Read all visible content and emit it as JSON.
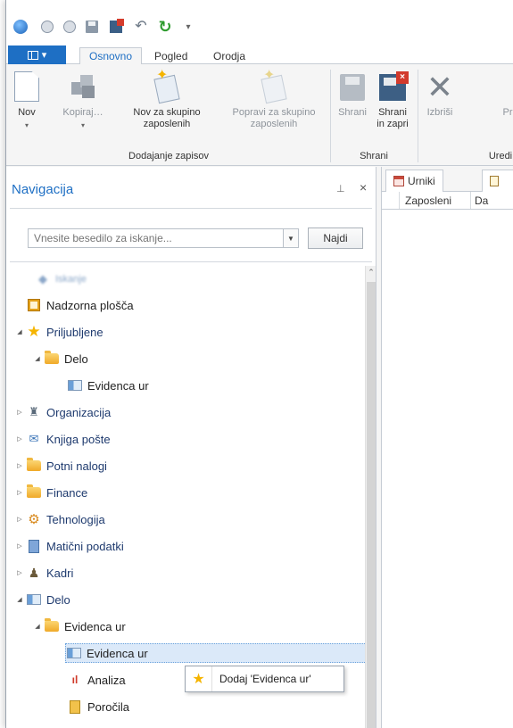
{
  "quick_access": {
    "icons": [
      "app-orb-icon",
      "back-icon",
      "forward-icon",
      "save-icon",
      "save-close-icon",
      "undo-icon",
      "refresh-icon",
      "customize-icon"
    ]
  },
  "ribbon_tabs": {
    "file_label": "",
    "tabs": [
      "Osnovno",
      "Pogled",
      "Orodja"
    ],
    "active": "Osnovno"
  },
  "ribbon": {
    "buttons": {
      "nov": "Nov",
      "kopiraj": "Kopiraj…",
      "nov_skupino_1": "Nov za skupino",
      "nov_skupino_2": "zaposlenih",
      "popravi_1": "Popravi za skupino",
      "popravi_2": "zaposlenih",
      "shrani": "Shrani",
      "shrani_zapri_1": "Shrani",
      "shrani_zapri_2": "in zapri",
      "izbrisi": "Izbriši",
      "cut_off": "Pr"
    },
    "groups": {
      "dodajanje": "Dodajanje zapisov",
      "shrani": "Shrani",
      "uredi": "Uredi"
    }
  },
  "navigation": {
    "title": "Navigacija",
    "pin_glyph": "ᵖ",
    "close_glyph": "×",
    "search_placeholder": "Vnesite besedilo za iskanje...",
    "search_button": "Najdi",
    "tree": [
      {
        "label": "<blurred>",
        "level": 0
      },
      {
        "label": "Nadzorna plošča",
        "level": 0
      },
      {
        "label": "Priljubljene",
        "level": 0
      },
      {
        "label": "Delo",
        "level": 1
      },
      {
        "label": "Evidenca ur",
        "level": 2
      },
      {
        "label": "Organizacija",
        "level": 0
      },
      {
        "label": "Knjiga pošte",
        "level": 0
      },
      {
        "label": "Potni nalogi",
        "level": 0
      },
      {
        "label": "Finance",
        "level": 0
      },
      {
        "label": "Tehnologija",
        "level": 0
      },
      {
        "label": "Matični podatki",
        "level": 0
      },
      {
        "label": "Kadri",
        "level": 0
      },
      {
        "label": "Delo",
        "level": 0
      },
      {
        "label": "Evidenca ur",
        "level": 1
      },
      {
        "label": "Evidenca ur",
        "level": 2
      },
      {
        "label": "Analiza",
        "level": 2
      },
      {
        "label": "Poročila",
        "level": 2
      }
    ],
    "blurred_label": "Iskanje"
  },
  "context_menu": {
    "item": "Dodaj 'Evidenca ur'"
  },
  "document": {
    "tabs": [
      "Urniki",
      ""
    ],
    "columns": [
      "Zaposleni",
      "Da"
    ]
  },
  "colors": {
    "accent": "#1e6fc4",
    "tree_text": "#1e3a6e",
    "selection": "#dbe9f9"
  }
}
